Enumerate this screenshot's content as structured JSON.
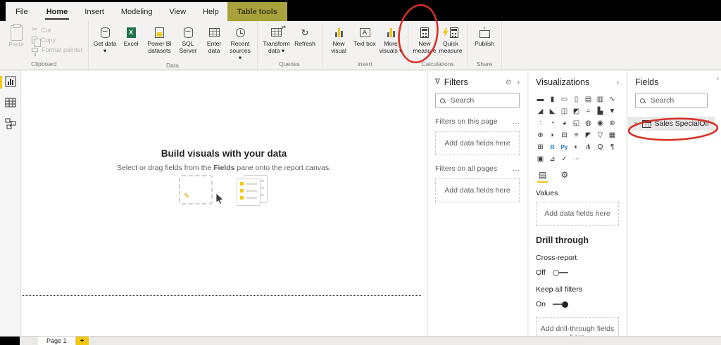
{
  "chrome": {
    "file_tab": "File",
    "tabs": [
      "Home",
      "Insert",
      "Modeling",
      "View",
      "Help"
    ],
    "contextual_tab": "Table tools"
  },
  "ribbon": {
    "clipboard": {
      "label": "Clipboard",
      "paste": "Paste",
      "cut": "Cut",
      "copy": "Copy",
      "format_painter": "Format painter"
    },
    "data": {
      "label": "Data",
      "get_data": "Get data ▾",
      "excel": "Excel",
      "pbi_datasets": "Power BI datasets",
      "sql_server": "SQL Server",
      "enter_data": "Enter data",
      "recent_sources": "Recent sources ▾"
    },
    "queries": {
      "label": "Queries",
      "transform": "Transform data ▾",
      "refresh": "Refresh"
    },
    "insert": {
      "label": "Insert",
      "new_visual": "New visual",
      "text_box": "Text box",
      "more_visuals": "More visuals ▾"
    },
    "calculations": {
      "label": "Calculations",
      "new_measure": "New measure",
      "quick_measure": "Quick measure"
    },
    "share": {
      "label": "Share",
      "publish": "Publish"
    }
  },
  "canvas": {
    "title": "Build visuals with your data",
    "subtitle_pre": "Select or drag fields from the ",
    "subtitle_bold": "Fields",
    "subtitle_post": " pane onto the report canvas."
  },
  "filters": {
    "title": "Filters",
    "search_placeholder": "Search",
    "section_this_page": "Filters on this page",
    "section_all_pages": "Filters on all pages",
    "add_fields_hint": "Add data fields here"
  },
  "visualizations": {
    "title": "Visualizations",
    "values_label": "Values",
    "add_fields_hint": "Add data fields here",
    "drill_through": "Drill through",
    "cross_report": "Cross-report",
    "off_label": "Off",
    "keep_all_filters": "Keep all filters",
    "on_label": "On",
    "add_drill_hint": "Add drill-through fields here",
    "icons": [
      {
        "name": "stacked-bar-chart",
        "glyph": "▬"
      },
      {
        "name": "stacked-column-chart",
        "glyph": "▮"
      },
      {
        "name": "clustered-bar-chart",
        "glyph": "▭"
      },
      {
        "name": "clustered-column-chart",
        "glyph": "▯"
      },
      {
        "name": "100-stacked-bar-chart",
        "glyph": "▤"
      },
      {
        "name": "100-stacked-column-chart",
        "glyph": "▥"
      },
      {
        "name": "line-chart",
        "glyph": "∿"
      },
      {
        "name": "area-chart",
        "glyph": "◢"
      },
      {
        "name": "stacked-area-chart",
        "glyph": "◣"
      },
      {
        "name": "line-and-stacked-column-chart",
        "glyph": "◫"
      },
      {
        "name": "line-and-clustered-column-chart",
        "glyph": "◩"
      },
      {
        "name": "ribbon-chart",
        "glyph": "≈"
      },
      {
        "name": "waterfall-chart",
        "glyph": "▙"
      },
      {
        "name": "funnel-chart",
        "glyph": "▼"
      },
      {
        "name": "scatter-chart",
        "glyph": "∴"
      },
      {
        "name": "pie-chart",
        "glyph": "◔"
      },
      {
        "name": "donut-chart",
        "glyph": "◕"
      },
      {
        "name": "treemap",
        "glyph": "◱"
      },
      {
        "name": "map",
        "glyph": "◍"
      },
      {
        "name": "filled-map",
        "glyph": "◉"
      },
      {
        "name": "shape-map",
        "glyph": "⊚"
      },
      {
        "name": "azure-map",
        "glyph": "⊕"
      },
      {
        "name": "gauge",
        "glyph": "◗"
      },
      {
        "name": "card",
        "glyph": "⊟"
      },
      {
        "name": "multi-row-card",
        "glyph": "≡"
      },
      {
        "name": "kpi",
        "glyph": "◤"
      },
      {
        "name": "slicer",
        "glyph": "▽"
      },
      {
        "name": "table",
        "glyph": "▦"
      },
      {
        "name": "matrix",
        "glyph": "⊞"
      },
      {
        "name": "r-script",
        "glyph": "R"
      },
      {
        "name": "python-script",
        "glyph": "Py"
      },
      {
        "name": "key-influencers",
        "glyph": "◐"
      },
      {
        "name": "decomposition-tree",
        "glyph": "⋔"
      },
      {
        "name": "qa",
        "glyph": "Q"
      },
      {
        "name": "smart-narrative",
        "glyph": "¶"
      },
      {
        "name": "paginated-report",
        "glyph": "▣"
      },
      {
        "name": "power-apps",
        "glyph": "⊿"
      },
      {
        "name": "metrics",
        "glyph": "✓"
      },
      {
        "name": "more-options",
        "glyph": "⋯"
      }
    ]
  },
  "fields": {
    "title": "Fields",
    "search_placeholder": "Search",
    "table_name": "Sales SpecialOffer"
  },
  "pages": {
    "page_label": "Page 1",
    "add_page": "+"
  },
  "glyphs": {
    "chevron_right": "›",
    "chevron_down": "∨",
    "funnel": "∇",
    "eye": "⊙",
    "refresh": "↻",
    "cut": "✂",
    "transform_arrows": "⇄",
    "fields_tab": "▤",
    "format_tab": "⚙",
    "more": "…",
    "pencil": "✎"
  },
  "colors": {
    "accent_yellow": "#f2c811",
    "annotation_red": "#d93025",
    "contextual_tab_bg": "#a8a23d",
    "excel_green": "#217346"
  }
}
